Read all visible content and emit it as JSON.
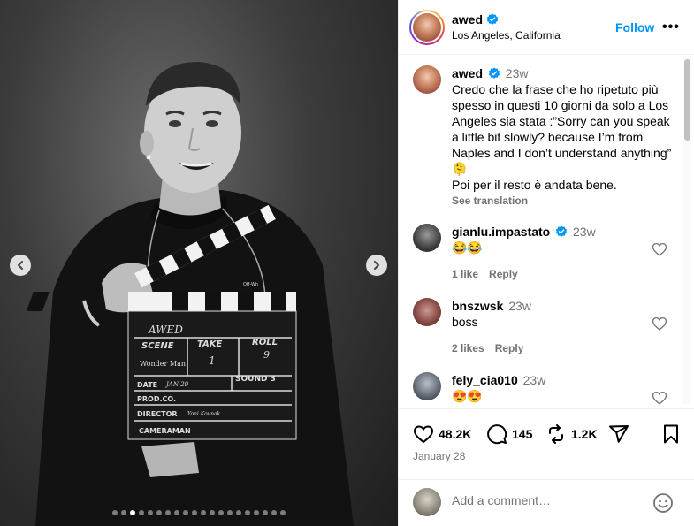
{
  "post": {
    "author": "awed",
    "location": "Los Angeles, California",
    "follow_label": "Follow",
    "more_label": "•••",
    "carousel": {
      "total_slides": 20,
      "active_slide": 3
    },
    "caption": {
      "username": "awed",
      "time": "23w",
      "text": "Credo che la frase che ho ripetuto più spesso in questi 10 giorni da solo a Los Angeles sia stata :”Sorry can you speak a little bit slowly? because I’m from Naples and I don’t understand anything” 🫠\nPoi per il resto è andata bene.",
      "see_translation": "See translation"
    },
    "photo_text": {
      "clap_name": "AWED",
      "scene_label": "SCENE",
      "take_label": "TAKE",
      "roll_label": "ROLL",
      "scene_value": "Wonder Man",
      "take_value": "1",
      "roll_value": "9",
      "date_label": "DATE",
      "date_value": "JAN 29",
      "sound_label": "SOUND 3",
      "prodco_label": "PROD.CO.",
      "director_label": "DIRECTOR",
      "director_value": "Yoni Kovnak",
      "cameraman_label": "CAMERAMAN",
      "shirt_logo": "Off-Wh"
    },
    "comments": [
      {
        "username": "gianlu.impastato",
        "verified": true,
        "time": "23w",
        "text": "😂😂",
        "likes": "1 like",
        "reply": "Reply"
      },
      {
        "username": "bnszwsk",
        "verified": false,
        "time": "23w",
        "text": "boss",
        "likes": "2 likes",
        "reply": "Reply"
      },
      {
        "username": "fely_cia010",
        "verified": false,
        "time": "23w",
        "text": "😍😍",
        "likes": "",
        "reply": ""
      }
    ],
    "actions": {
      "likes": "48.2K",
      "comments": "145",
      "reposts": "1.2K"
    },
    "date": "January 28",
    "add_comment_placeholder": "Add a comment…",
    "colors": {
      "accent": "#0095f6",
      "muted": "#737373",
      "verified": "#0095f6"
    }
  }
}
